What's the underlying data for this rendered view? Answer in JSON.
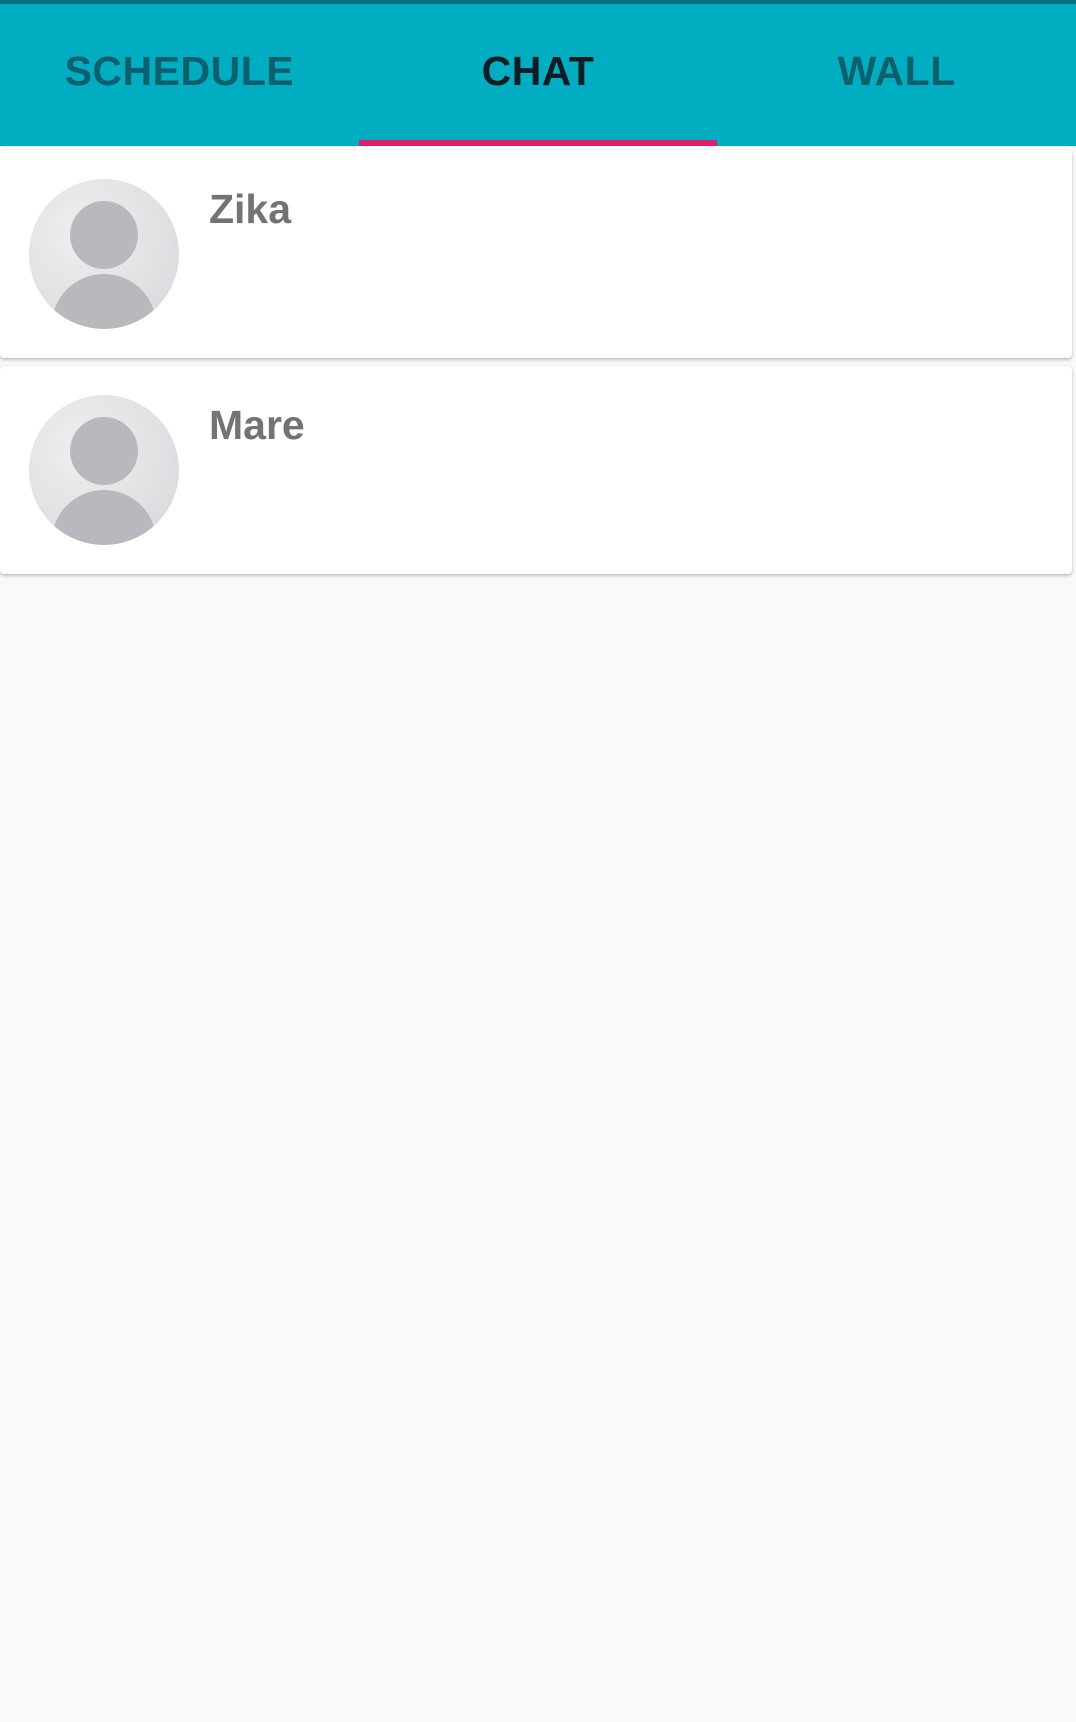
{
  "tabs": [
    {
      "label": "SCHEDULE",
      "active": false
    },
    {
      "label": "CHAT",
      "active": true
    },
    {
      "label": "WALL",
      "active": false
    }
  ],
  "colors": {
    "tabbar_background": "#00adc1",
    "tab_indicator": "#e01d6f",
    "inactive_tab_text": "#0c5f6c",
    "active_tab_text": "#0e1d21",
    "name_text": "#737373",
    "page_background": "#f9f9f9"
  },
  "chats": [
    {
      "name": "Zika",
      "avatar_icon": "default-user-avatar-icon"
    },
    {
      "name": "Mare",
      "avatar_icon": "default-user-avatar-icon"
    }
  ]
}
